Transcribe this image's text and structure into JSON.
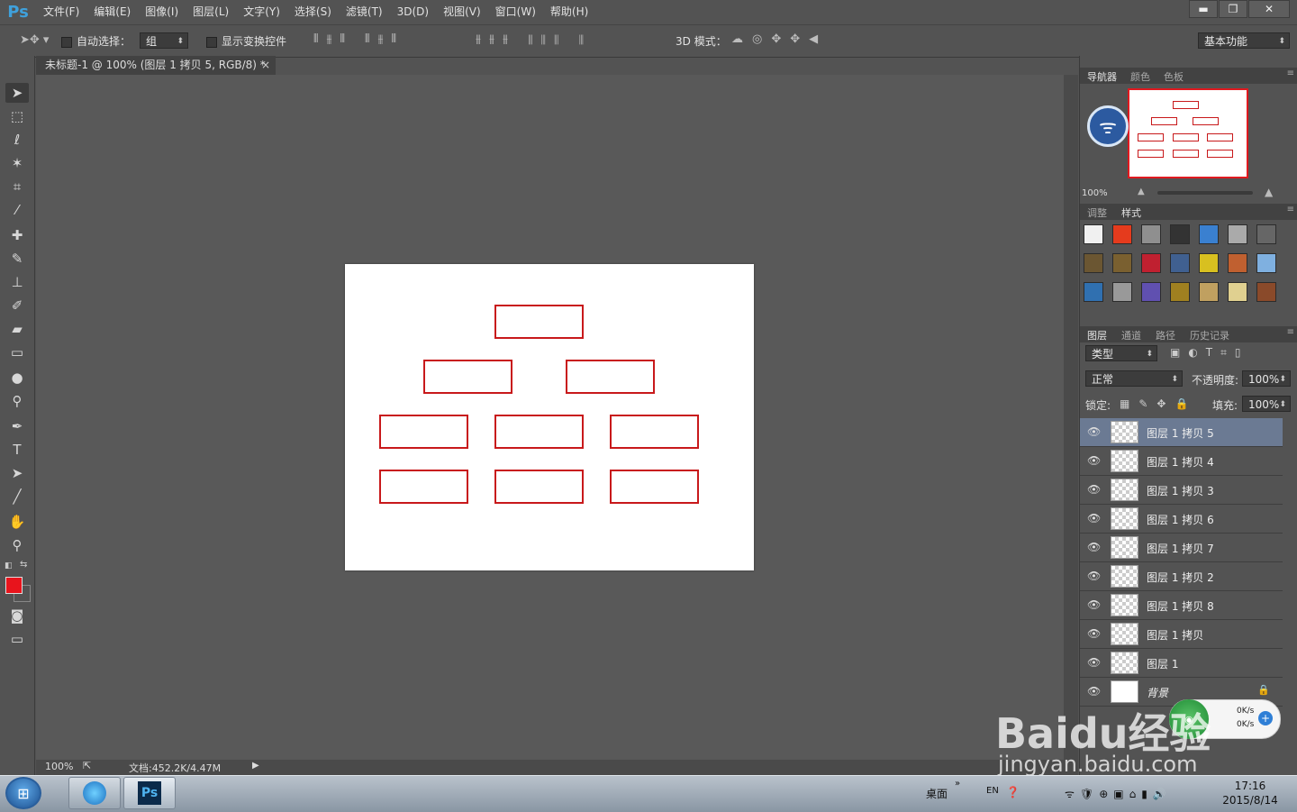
{
  "app": {
    "logo": "Ps"
  },
  "menu": [
    "文件(F)",
    "编辑(E)",
    "图像(I)",
    "图层(L)",
    "文字(Y)",
    "选择(S)",
    "滤镜(T)",
    "3D(D)",
    "视图(V)",
    "窗口(W)",
    "帮助(H)"
  ],
  "window_controls": {
    "minimize": "▬",
    "restore": "❐",
    "close": "✕"
  },
  "options": {
    "auto_select_label": "自动选择：",
    "auto_select_value": "组",
    "show_transform_label": "显示变换控件",
    "mode_3d_label": "3D 模式：",
    "workspace": "基本功能"
  },
  "document": {
    "tab_title": "未标题-1 @ 100% (图层 1 拷贝 5, RGB/8) *",
    "tab_close": "×",
    "zoom": "100%",
    "doc_info": "文档:452.2K/4.47M"
  },
  "colors": {
    "foreground": "#e8141c",
    "background": "#000000",
    "box_stroke": "#c8191b"
  },
  "navigator": {
    "tabs": [
      "导航器",
      "颜色",
      "色板"
    ],
    "zoom": "100%"
  },
  "styles_panel": {
    "tabs": [
      "调整",
      "样式"
    ]
  },
  "layers_panel": {
    "tabs": [
      "图层",
      "通道",
      "路径",
      "历史记录"
    ],
    "filter_kind": "类型",
    "blend_mode": "正常",
    "opacity_label": "不透明度:",
    "opacity_value": "100%",
    "lock_label": "锁定:",
    "fill_label": "填充:",
    "fill_value": "100%",
    "layers": [
      {
        "name": "图层 1 拷贝 5",
        "selected": true
      },
      {
        "name": "图层 1 拷贝 4",
        "selected": false
      },
      {
        "name": "图层 1 拷贝 3",
        "selected": false
      },
      {
        "name": "图层 1 拷贝 6",
        "selected": false
      },
      {
        "name": "图层 1 拷贝 7",
        "selected": false
      },
      {
        "name": "图层 1 拷贝 2",
        "selected": false
      },
      {
        "name": "图层 1 拷贝 8",
        "selected": false
      },
      {
        "name": "图层 1 拷贝",
        "selected": false
      },
      {
        "name": "图层 1",
        "selected": false
      },
      {
        "name": "背景",
        "selected": false
      }
    ]
  },
  "speed_widget": {
    "up": "0K/s",
    "down": "0K/s"
  },
  "taskbar": {
    "desktop_label": "桌面",
    "lang": "EN",
    "time": "17:16",
    "date": "2015/8/14"
  },
  "watermark": {
    "line1": "Baidu经验",
    "line2": "jingyan.baidu.com"
  }
}
